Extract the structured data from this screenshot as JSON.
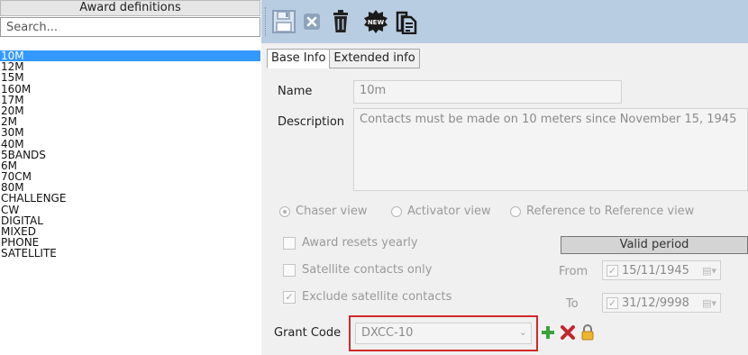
{
  "left_panel": {
    "header": "Award definitions",
    "search_placeholder": "Search...",
    "items": [
      "10M",
      "12M",
      "15M",
      "160M",
      "17M",
      "20M",
      "2M",
      "30M",
      "40M",
      "5BANDS",
      "6M",
      "70CM",
      "80M",
      "CHALLENGE",
      "CW",
      "DIGITAL",
      "MIXED",
      "PHONE",
      "SATELLITE"
    ],
    "selected": "10M"
  },
  "toolbar": {
    "buttons": [
      "save-icon",
      "cancel-icon",
      "delete-icon",
      "new-icon",
      "copy-icon"
    ],
    "new_badge": "NEW"
  },
  "tabs": [
    "Base Info",
    "Extended info"
  ],
  "form": {
    "name_label": "Name",
    "name_value": "10m",
    "description_label": "Description",
    "description_value": "Contacts must be made on 10 meters since November 15, 1945",
    "view_options": [
      "Chaser view",
      "Activator view",
      "Reference to Reference view"
    ],
    "selected_view": "Chaser view",
    "checkboxes": [
      {
        "label": "Award resets yearly",
        "checked": false
      },
      {
        "label": "Satellite contacts only",
        "checked": false
      },
      {
        "label": "Exclude satellite contacts",
        "checked": true
      }
    ],
    "valid_period_label": "Valid period",
    "from_label": "From",
    "from_value": "15/11/1945",
    "to_label": "To",
    "to_value": "31/12/9998",
    "grant_code_label": "Grant Code",
    "grant_code_value": "DXCC-10"
  },
  "colors": {
    "selection": "#3399ff",
    "toolbar": "#b9cde2",
    "highlight": "#d22a2a"
  }
}
